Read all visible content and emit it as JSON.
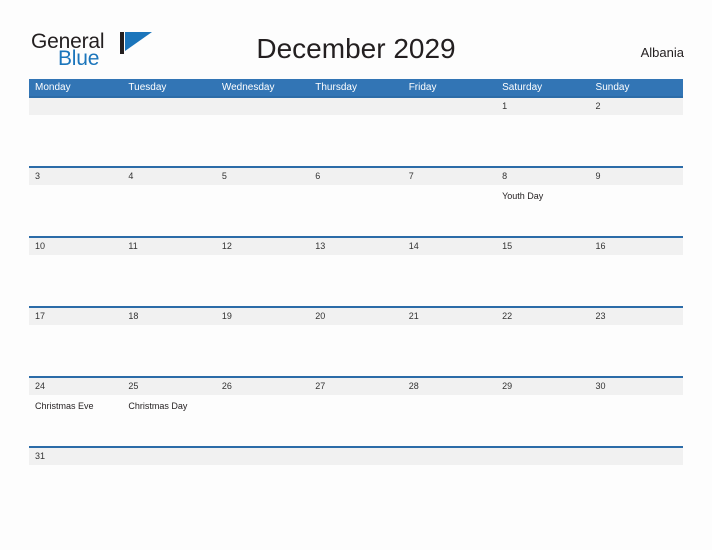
{
  "brand": {
    "name_part1": "General",
    "name_part2": "Blue",
    "mark_icon": "triangle-flag-icon",
    "accent_color": "#1b75bb"
  },
  "header": {
    "title": "December 2029",
    "region": "Albania"
  },
  "theme": {
    "header_blue": "#3275b5",
    "rule_blue": "#2c6ca8",
    "daynum_band_gray": "#f1f1f1",
    "page_background": "#fdfdfd",
    "text_dark": "#231f20"
  },
  "calendar": {
    "weekdays": [
      "Monday",
      "Tuesday",
      "Wednesday",
      "Thursday",
      "Friday",
      "Saturday",
      "Sunday"
    ],
    "weeks": [
      {
        "short": false,
        "days": [
          {
            "number": "",
            "event": ""
          },
          {
            "number": "",
            "event": ""
          },
          {
            "number": "",
            "event": ""
          },
          {
            "number": "",
            "event": ""
          },
          {
            "number": "",
            "event": ""
          },
          {
            "number": "1",
            "event": ""
          },
          {
            "number": "2",
            "event": ""
          }
        ]
      },
      {
        "short": false,
        "days": [
          {
            "number": "3",
            "event": ""
          },
          {
            "number": "4",
            "event": ""
          },
          {
            "number": "5",
            "event": ""
          },
          {
            "number": "6",
            "event": ""
          },
          {
            "number": "7",
            "event": ""
          },
          {
            "number": "8",
            "event": "Youth Day"
          },
          {
            "number": "9",
            "event": ""
          }
        ]
      },
      {
        "short": false,
        "days": [
          {
            "number": "10",
            "event": ""
          },
          {
            "number": "11",
            "event": ""
          },
          {
            "number": "12",
            "event": ""
          },
          {
            "number": "13",
            "event": ""
          },
          {
            "number": "14",
            "event": ""
          },
          {
            "number": "15",
            "event": ""
          },
          {
            "number": "16",
            "event": ""
          }
        ]
      },
      {
        "short": false,
        "days": [
          {
            "number": "17",
            "event": ""
          },
          {
            "number": "18",
            "event": ""
          },
          {
            "number": "19",
            "event": ""
          },
          {
            "number": "20",
            "event": ""
          },
          {
            "number": "21",
            "event": ""
          },
          {
            "number": "22",
            "event": ""
          },
          {
            "number": "23",
            "event": ""
          }
        ]
      },
      {
        "short": false,
        "days": [
          {
            "number": "24",
            "event": "Christmas Eve"
          },
          {
            "number": "25",
            "event": "Christmas Day"
          },
          {
            "number": "26",
            "event": ""
          },
          {
            "number": "27",
            "event": ""
          },
          {
            "number": "28",
            "event": ""
          },
          {
            "number": "29",
            "event": ""
          },
          {
            "number": "30",
            "event": ""
          }
        ]
      },
      {
        "short": true,
        "days": [
          {
            "number": "31",
            "event": ""
          },
          {
            "number": "",
            "event": ""
          },
          {
            "number": "",
            "event": ""
          },
          {
            "number": "",
            "event": ""
          },
          {
            "number": "",
            "event": ""
          },
          {
            "number": "",
            "event": ""
          },
          {
            "number": "",
            "event": ""
          }
        ]
      }
    ]
  }
}
